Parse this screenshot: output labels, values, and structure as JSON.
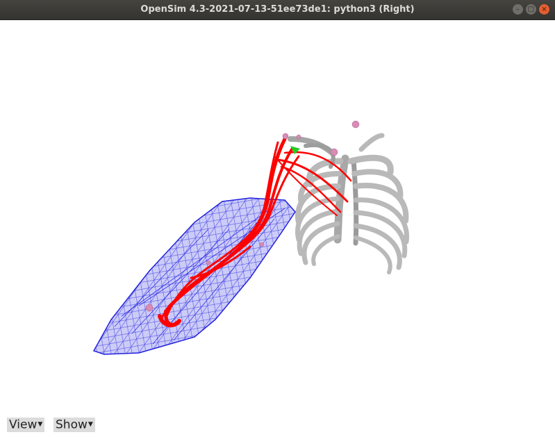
{
  "window": {
    "title": "OpenSim 4.3-2021-07-13-51ee73de1: python3 (Right)",
    "buttons": [
      "minimize",
      "maximize",
      "close"
    ]
  },
  "scene": {
    "bones_color": "#b9b9b9",
    "muscle_color": "#ff0000",
    "wrap_object_color": "#2020dd",
    "marker_color": "#d98bb5"
  },
  "controls": {
    "view_label": "View",
    "show_label": "Show"
  },
  "icons": {
    "dropdown": "caret-down-icon"
  }
}
